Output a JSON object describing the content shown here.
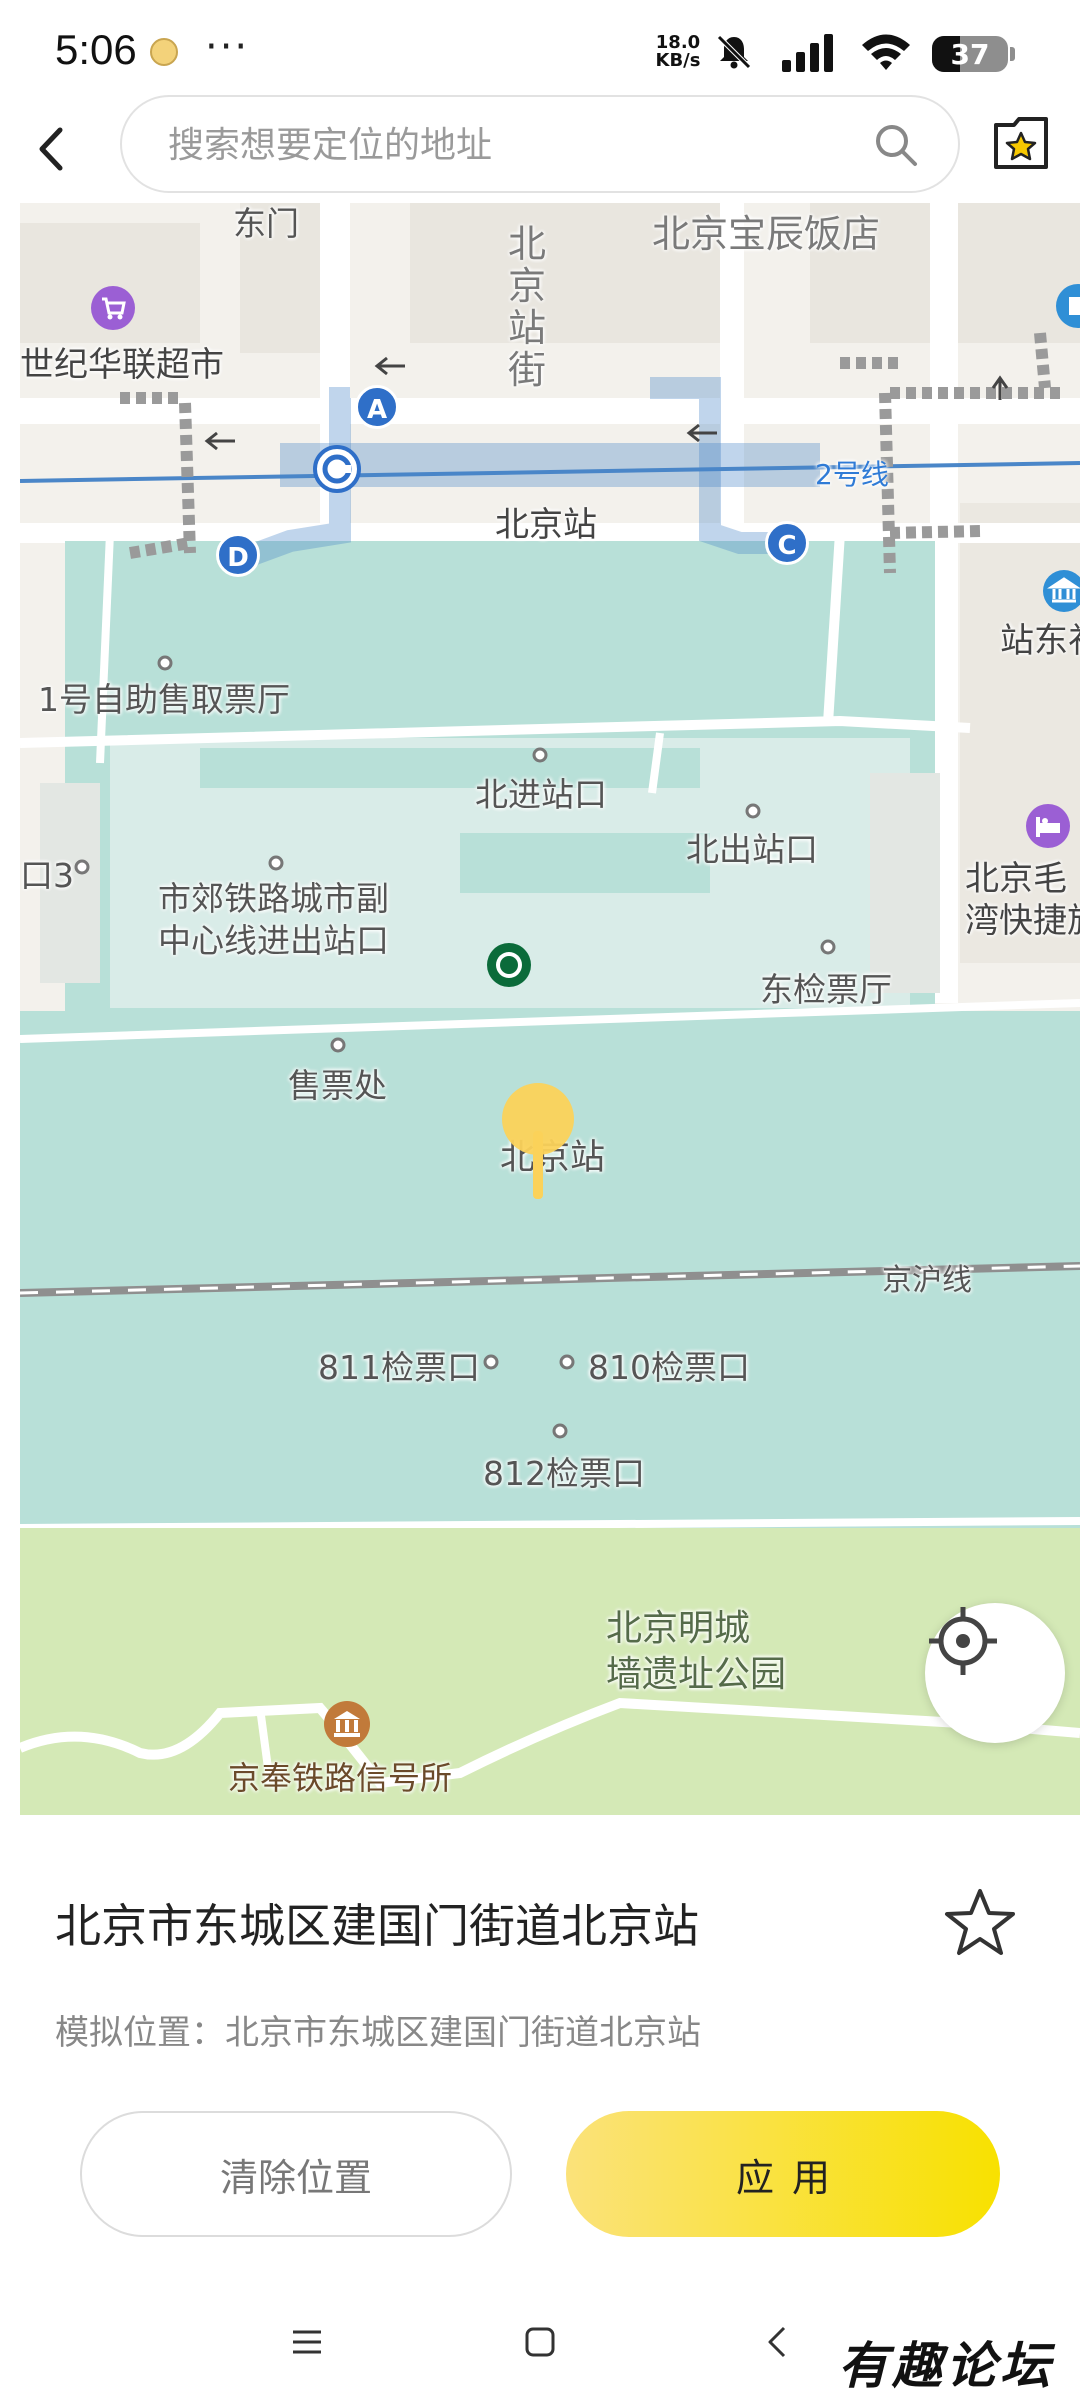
{
  "status_bar": {
    "time": "5:06",
    "dots": "···",
    "net_speed_value": "18.0",
    "net_speed_unit": "KB/s",
    "battery_level": "37",
    "battery_fraction": 0.37
  },
  "top_bar": {
    "search_placeholder": "搜索想要定位的地址",
    "icons": [
      "chevron-left-icon",
      "search-icon",
      "star-folder-icon"
    ]
  },
  "map": {
    "labels": {
      "dongmen": "东门",
      "baochen_hotel": "北京宝辰饭店",
      "beijingzhan_street": "北京站街",
      "hualian": "世纪华联超市",
      "line2": "2号线",
      "station_top": "北京站",
      "zhandong": "站东礼",
      "ticket_hall": "1号自助售取票厅",
      "north_in": "北进站口",
      "north_out": "北出站口",
      "exit3": "口3",
      "suburban": "市郊铁路城市副\n中心线进出站口",
      "maojia": "北京毛\n湾快捷旅",
      "east_ticket": "东检票厅",
      "ticket_office": "售票处",
      "station_center": "北京站",
      "jinghu": "京沪线",
      "gate811": "811检票口",
      "gate810": "810检票口",
      "gate812": "812检票口",
      "ming_park": "北京明城\n墙遗址公园",
      "signal_house": "京奉铁路信号所"
    },
    "subway_exits": [
      "A",
      "C",
      "D"
    ],
    "colors": {
      "platform": "#b8e0d8",
      "park": "#d4e9b6",
      "subway": "#4a86c8",
      "pin": "#fbd25a"
    }
  },
  "sheet": {
    "address_title": "北京市东城区建国门街道北京站",
    "sim_location": "模拟位置：北京市东城区建国门街道北京站",
    "clear_label": "清除位置",
    "apply_label": "应用"
  },
  "watermark": "有趣论坛"
}
